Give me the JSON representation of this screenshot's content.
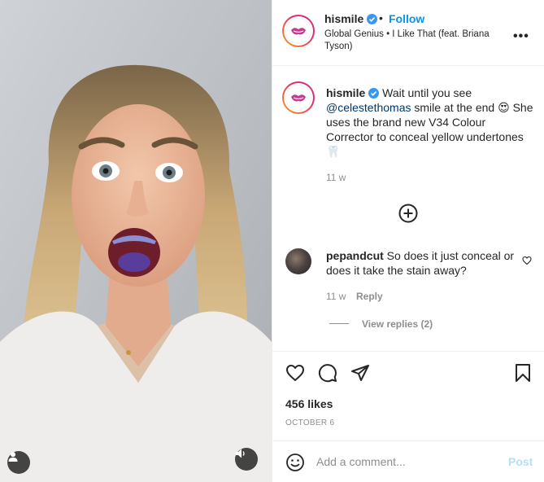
{
  "post": {
    "author": "hismile",
    "follow_label": "Follow",
    "dot": "•",
    "audio": "Global Genius • I Like That (feat. Briana Tyson)",
    "more": "•••"
  },
  "caption": {
    "username": "hismile",
    "text_before_mention": " Wait until you see ",
    "mention": "@celestethomas",
    "text_after_mention": " smile at the end 😍 She uses the brand new V34 Colour Corrector to conceal yellow undertones 🦷",
    "time": "11 w"
  },
  "comments": [
    {
      "username": "pepandcut",
      "text": " So does it just conceal or does it take the stain away?",
      "time": "11 w",
      "reply_label": "Reply",
      "view_replies_label": "View replies (2)"
    }
  ],
  "engagement": {
    "likes": "456 likes",
    "date": "OCTOBER 6"
  },
  "composer": {
    "placeholder": "Add a comment...",
    "post_label": "Post"
  },
  "colors": {
    "accent": "#0095f6",
    "post_disabled": "#b2dffc",
    "muted": "#8e8e8e",
    "brand_logo": "#c9398f"
  },
  "icons": {
    "verified": "verified-badge-icon",
    "load_more": "plus-circle-icon",
    "like": "heart-icon",
    "comment": "speech-bubble-icon",
    "share": "paper-plane-icon",
    "save": "bookmark-icon",
    "emoji": "smiley-icon",
    "user_tags": "person-icon",
    "audio": "speaker-icon"
  }
}
